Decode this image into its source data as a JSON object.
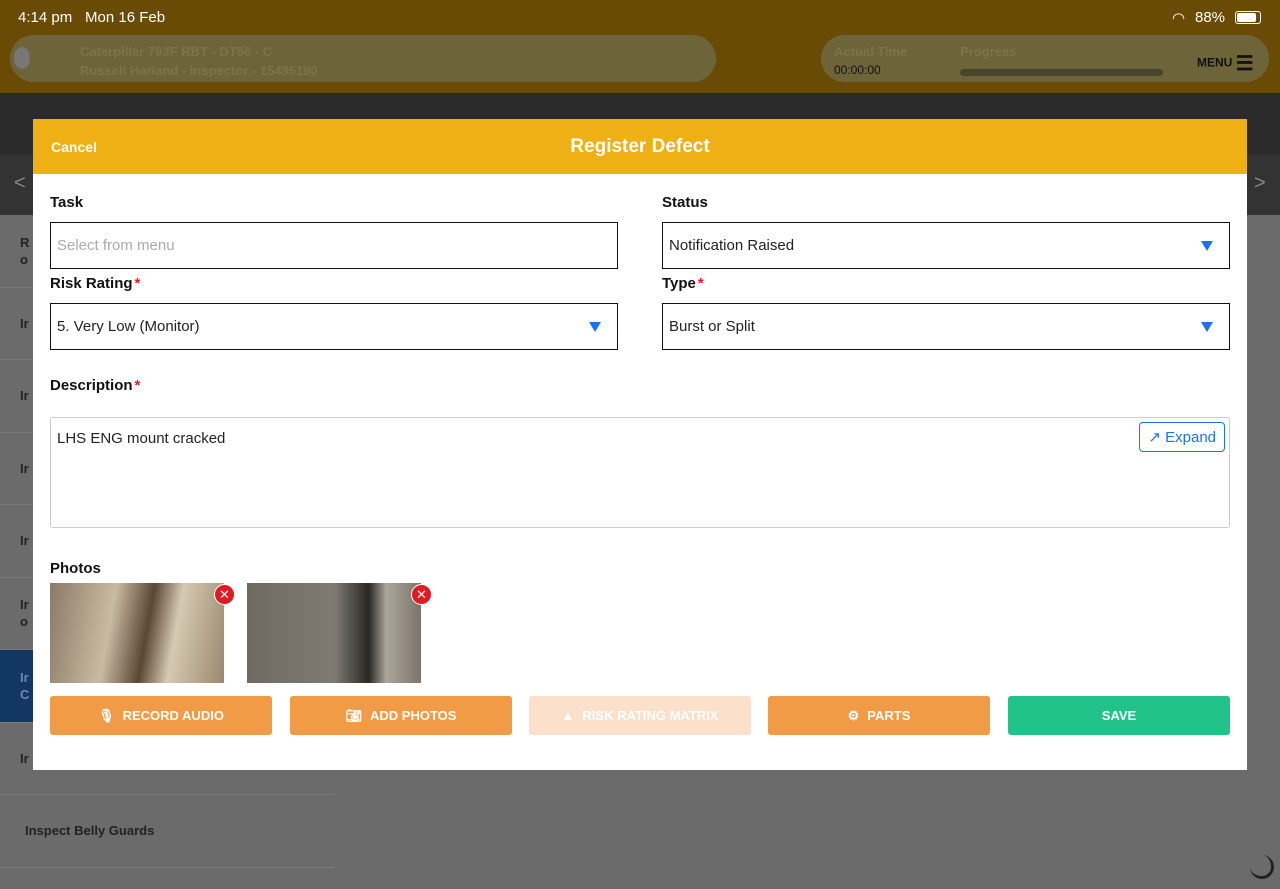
{
  "status_bar": {
    "time": "4:14 pm",
    "date": "Mon 16 Feb",
    "battery": "88%"
  },
  "header": {
    "machine": "Caterpillar 793F RBT - DT56 - C",
    "user": "Russell Harland - Inspector - 15495190",
    "actual_time_label": "Actual Time",
    "actual_time": "00:00:00",
    "progress_label": "Progress",
    "progress": 0,
    "menu": "MENU"
  },
  "list": {
    "items": [
      "R o",
      "Ir",
      "Ir",
      "Ir",
      "Ir",
      "Ir o",
      "Ir C",
      "Ir",
      "Inspect Belly Guards"
    ]
  },
  "modal": {
    "cancel": "Cancel",
    "title": "Register Defect",
    "task_label": "Task",
    "task_placeholder": "Select from menu",
    "status_label": "Status",
    "status_value": "Notification Raised",
    "risk_label": "Risk Rating",
    "risk_value": "5. Very Low (Monitor)",
    "type_label": "Type",
    "type_value": "Burst or Split",
    "description_label": "Description",
    "description_value": "LHS ENG mount cracked",
    "expand": "Expand",
    "photos_label": "Photos",
    "buttons": {
      "record": "RECORD AUDIO",
      "add_photos": "ADD PHOTOS",
      "risk_matrix": "RISK RATING MATRIX",
      "parts": "PARTS",
      "save": "SAVE"
    }
  },
  "colors": {
    "accent": "#eeb015",
    "button": "#f29b47",
    "save": "#21c38b",
    "link": "#1a73e8"
  }
}
